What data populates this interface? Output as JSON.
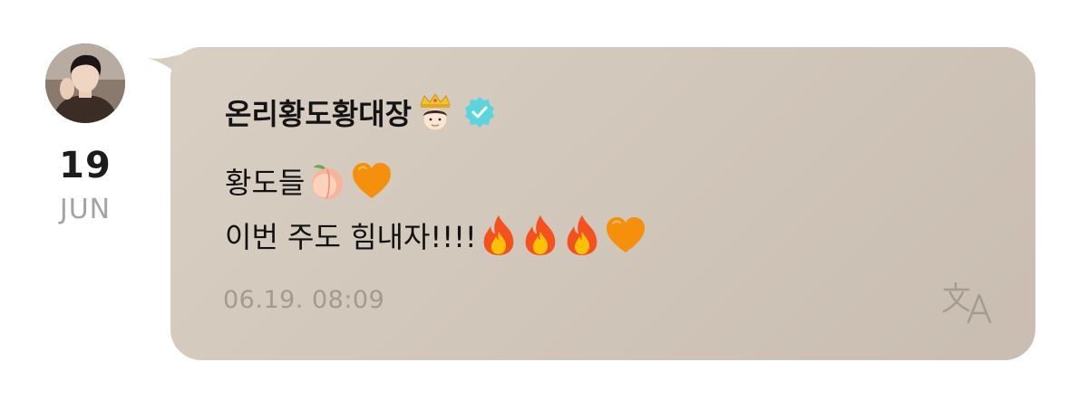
{
  "post": {
    "date_day": "19",
    "date_month": "JUN",
    "sender_name": "온리황도황대장",
    "message_line1": "황도들",
    "message_line2": "이번 주도 힘내자!!!!",
    "timestamp": "06.19. 08:09"
  },
  "icons": {
    "avatar": "profile-photo",
    "name_emoji": "crowned-face-emoji",
    "verified": "verified-badge-icon",
    "line1_emojis": [
      "peach-emoji",
      "orange-heart-emoji"
    ],
    "line2_emojis": [
      "fire-emoji",
      "fire-emoji",
      "fire-emoji",
      "orange-heart-emoji"
    ],
    "translate": "translate-icon"
  },
  "colors": {
    "bubble": "#d3c8bc",
    "verified": "#5ad5dd",
    "timestamp": "#a39a90",
    "month": "#a3a3a3"
  }
}
